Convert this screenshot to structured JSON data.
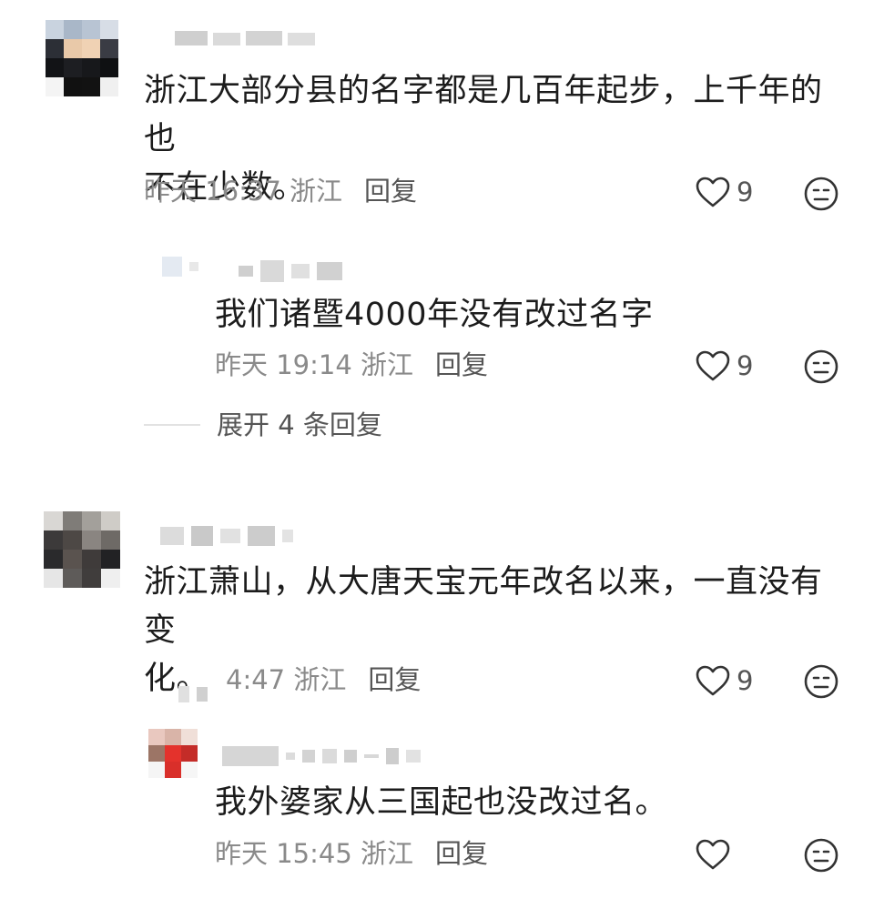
{
  "comments": [
    {
      "text": "浙江大部分县的名字都是几百年起步，上千年的也\n不在少数。",
      "time": "昨天 16:37",
      "location": "浙江",
      "reply_label": "回复",
      "likes": "9",
      "replies": [
        {
          "text": "我们诸暨4000年没有改过名字",
          "time": "昨天 19:14",
          "location": "浙江",
          "reply_label": "回复",
          "likes": "9"
        }
      ],
      "expand_label": "展开 4 条回复"
    },
    {
      "text": "浙江萧山，从大唐天宝元年改名以来，一直没有变\n化。",
      "time": "4:47",
      "location": "浙江",
      "reply_label": "回复",
      "likes": "9",
      "replies": [
        {
          "text": "我外婆家从三国起也没改过名。",
          "time": "昨天 15:45",
          "location": "浙江",
          "reply_label": "回复",
          "likes": ""
        }
      ]
    }
  ],
  "icons": {
    "like": "heart-outline-icon",
    "dislike": "neutral-face-icon"
  },
  "colors": {
    "text": "#1c1c1c",
    "meta": "#8a8a8a",
    "icon": "#333333"
  }
}
